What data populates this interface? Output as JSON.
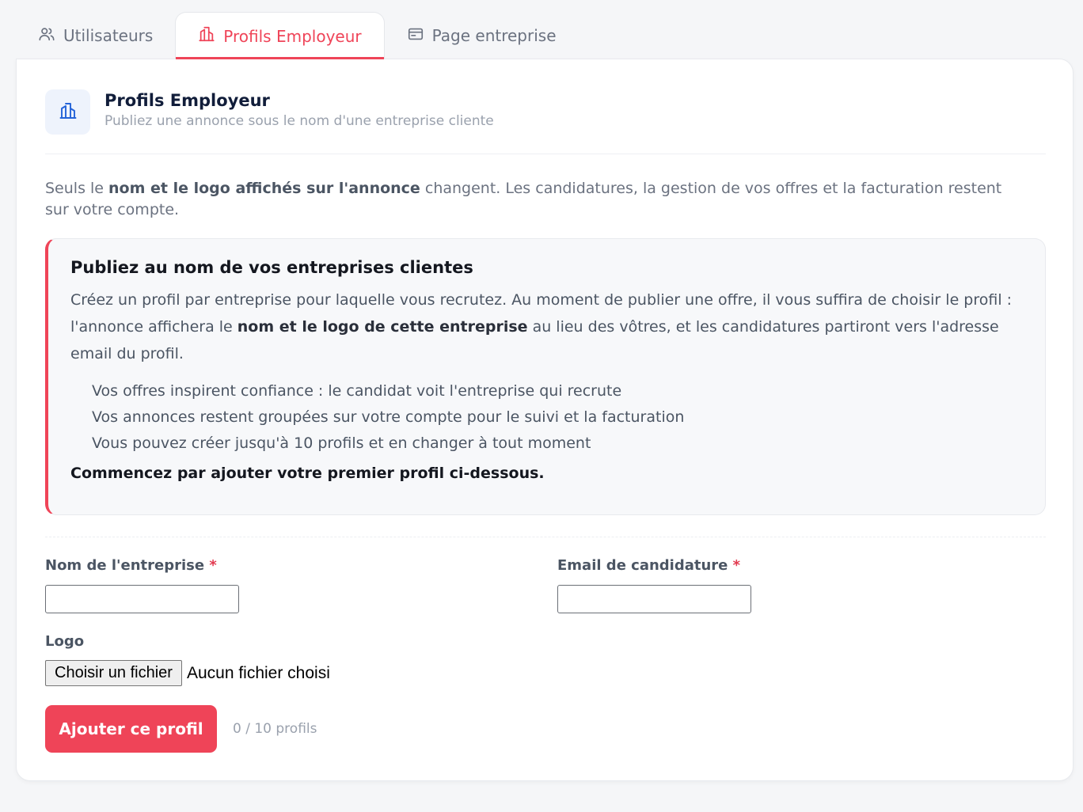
{
  "tabs": [
    {
      "label": "Utilisateurs",
      "icon": "users-icon",
      "active": false
    },
    {
      "label": "Profils Employeur",
      "icon": "building-icon",
      "active": true
    },
    {
      "label": "Page entreprise",
      "icon": "browser-window-icon",
      "active": false
    }
  ],
  "colors": {
    "accent": "#ef4458",
    "title": "#111d3a",
    "icon_blue": "#2463d8",
    "muted": "#9aa1ad"
  },
  "header": {
    "icon": "building-icon",
    "title": "Profils Employeur",
    "subtitle": "Publiez une annonce sous le nom d'une entreprise cliente"
  },
  "intro": {
    "before": "Seuls le ",
    "bold": "nom et le logo affichés sur l'annonce",
    "after": " changent. Les candidatures, la gestion de vos offres et la facturation restent sur votre compte."
  },
  "callout": {
    "title": "Publiez au nom de vos entreprises clientes",
    "text_before": "Créez un profil par entreprise pour laquelle vous recrutez. Au moment de publier une offre, il vous suffira de choisir le profil : l'annonce affichera le ",
    "text_bold": "nom et le logo de cette entreprise",
    "text_after": " au lieu des vôtres, et les candidatures partiront vers l'adresse email du profil.",
    "bullets": [
      "Vos offres inspirent confiance : le candidat voit l'entreprise qui recrute",
      "Vos annonces restent groupées sur votre compte pour le suivi et la facturation",
      "Vous pouvez créer jusqu'à 10 profils et en changer à tout moment"
    ],
    "cta": "Commencez par ajouter votre premier profil ci-dessous."
  },
  "form": {
    "company_label": "Nom de l'entreprise",
    "company_value": "",
    "email_label": "Email de candidature",
    "email_value": "",
    "required_mark": "*",
    "logo_label": "Logo",
    "file_button": "Choisir un fichier",
    "file_status": "Aucun fichier choisi",
    "submit_label": "Ajouter ce profil",
    "counter": "0 / 10 profils"
  }
}
